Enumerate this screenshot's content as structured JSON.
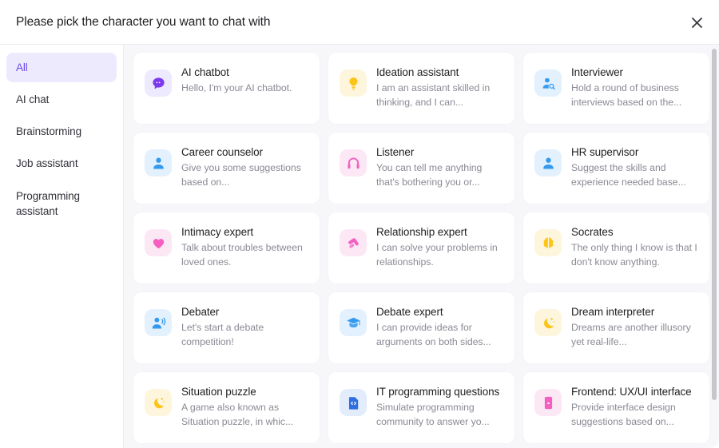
{
  "header": {
    "title": "Please pick the character you want to chat with",
    "close_icon": "close-icon"
  },
  "sidebar": {
    "items": [
      {
        "label": "All",
        "active": true
      },
      {
        "label": "AI chat",
        "active": false
      },
      {
        "label": "Brainstorming",
        "active": false
      },
      {
        "label": "Job assistant",
        "active": false
      },
      {
        "label": "Programming assistant",
        "active": false
      }
    ]
  },
  "colors": {
    "accent": "#7048e8",
    "accent_bg": "#eeeafd",
    "purple": "#7c3aed",
    "purple_bg": "#ede9fe",
    "yellow": "#fcc419",
    "yellow_bg": "#fdf6dd",
    "blue": "#339af0",
    "blue_bg": "#e3f0fd",
    "pink": "#f council",
    "pink_icon": "#f45fc0",
    "pink_bg": "#fce7f5",
    "card_bg": "#ffffff",
    "content_bg": "#f7f7f9",
    "title_text": "#1f1f23",
    "desc_text": "#8a8a95"
  },
  "cards": [
    {
      "title": "AI chatbot",
      "desc": "Hello, I'm your AI chatbot.",
      "icon": "chat-bubble-icon",
      "icon_color": "#7c3aed",
      "icon_bg": "#ede9fe"
    },
    {
      "title": "Ideation assistant",
      "desc": "I am an assistant skilled in thinking, and I can...",
      "icon": "lightbulb-icon",
      "icon_color": "#fcc419",
      "icon_bg": "#fdf6dd"
    },
    {
      "title": "Interviewer",
      "desc": "Hold a round of business interviews based on the...",
      "icon": "person-search-icon",
      "icon_color": "#339af0",
      "icon_bg": "#e3f0fd"
    },
    {
      "title": "Career counselor",
      "desc": "Give you some suggestions based on...",
      "icon": "person-icon",
      "icon_color": "#339af0",
      "icon_bg": "#e3f0fd"
    },
    {
      "title": "Listener",
      "desc": "You can tell me anything that's bothering you or...",
      "icon": "headphones-icon",
      "icon_color": "#f45fc0",
      "icon_bg": "#fce7f5"
    },
    {
      "title": "HR supervisor",
      "desc": "Suggest the skills and experience needed base...",
      "icon": "person-icon",
      "icon_color": "#339af0",
      "icon_bg": "#e3f0fd"
    },
    {
      "title": "Intimacy expert",
      "desc": "Talk about troubles between loved ones.",
      "icon": "heart-icon",
      "icon_color": "#f45fc0",
      "icon_bg": "#fce7f5"
    },
    {
      "title": "Relationship expert",
      "desc": "I can solve your problems in relationships.",
      "icon": "handshake-icon",
      "icon_color": "#f45fc0",
      "icon_bg": "#fce7f5"
    },
    {
      "title": "Socrates",
      "desc": "The only thing I know is that I don't know anything.",
      "icon": "brain-icon",
      "icon_color": "#fcc419",
      "icon_bg": "#fdf6dd"
    },
    {
      "title": "Debater",
      "desc": "Let's start a debate competition!",
      "icon": "person-speaking-icon",
      "icon_color": "#339af0",
      "icon_bg": "#e3f0fd"
    },
    {
      "title": "Debate expert",
      "desc": "I can provide ideas for arguments on both sides...",
      "icon": "graduation-cap-icon",
      "icon_color": "#339af0",
      "icon_bg": "#e3f0fd"
    },
    {
      "title": "Dream interpreter",
      "desc": "Dreams are another illusory yet real-life...",
      "icon": "moon-stars-icon",
      "icon_color": "#fcc419",
      "icon_bg": "#fdf6dd"
    },
    {
      "title": "Situation puzzle",
      "desc": "A game also known as Situation puzzle, in whic...",
      "icon": "moon-stars-icon",
      "icon_color": "#fcc419",
      "icon_bg": "#fdf6dd"
    },
    {
      "title": "IT programming questions",
      "desc": "Simulate programming community to answer yo...",
      "icon": "code-file-icon",
      "icon_color": "#2f6fe0",
      "icon_bg": "#e3ecfb"
    },
    {
      "title": "Frontend: UX/UI interface",
      "desc": "Provide interface design suggestions based on...",
      "icon": "mobile-phone-icon",
      "icon_color": "#f45fc0",
      "icon_bg": "#fce7f5"
    }
  ]
}
